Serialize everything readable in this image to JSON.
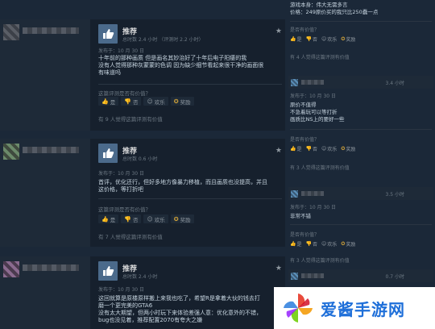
{
  "left_reviews": [
    {
      "recommendation": "推荐",
      "hours": "总时数 2.4 小时  （评测时 2.2 小时）",
      "posted": "发布于：10 月 30 日",
      "text": "十年前的那种画质 但是画名其妙治好了十年后电子阳痿的我\n没有人觉得那种灰蒙蒙的色调 因为缺少细节看起来很干净的画面很\n有味道吗",
      "helpful_question": "这篇评测是否有价值？",
      "votes": [
        "是",
        "否",
        "欢乐",
        "奖励"
      ],
      "found_helpful": "有 9 人觉得这篇评测有价值"
    },
    {
      "recommendation": "推荐",
      "hours": "总时数 0.6 小时",
      "posted": "发布于：10 月 30 日",
      "text": "首评，优化还行，但好多地方像暴力移植，而且画质也没提高，并且\n这价格，等打折吧",
      "helpful_question": "这篇评测是否有价值？",
      "votes": [
        "是",
        "否",
        "欢乐",
        "奖励"
      ],
      "found_helpful": "有 7 人觉得这篇评测有价值"
    },
    {
      "recommendation": "推荐",
      "hours": "总时数 2.4 小时",
      "posted": "发布于：10 月 30 日",
      "text": "这回就算是原楼原样搬上来我也吃了，希望R是拿着大伙的钱去打\n磨一个更完美的GTA6\n没有太大期望，但两小时玩下来体验差强人意：优化意外的不错，\nbug也没见着，推荐配置2070有夸大之嫌"
    }
  ],
  "right_column": {
    "top_lines": [
      "游戏本身：伟大无需多言",
      "价格：249原价买的我只比250蠢一点"
    ],
    "top_helpful_question": "是否有价值？",
    "top_votes": [
      "是",
      "否",
      "欢乐",
      "奖励"
    ],
    "top_found": "有 4 人觉得这篇评测有价值",
    "reviews": [
      {
        "hours": "3.4 小时",
        "posted": "发布于：10 月 30 日",
        "text": "原价不值得\n不急着玩可以等打折\n画质比NS上的要好一些",
        "helpful_question": "是否有价值？",
        "votes": [
          "是",
          "否",
          "欢乐",
          "奖励"
        ],
        "found": "有 3 人觉得这篇评测有价值"
      },
      {
        "hours": "3.5 小时",
        "posted": "发布于：10 月 30 日",
        "text": "非常不错",
        "helpful_question": "是否有价值？",
        "votes": [
          "是",
          "否",
          "欢乐",
          "奖励"
        ],
        "found": "有 3 人觉得这篇评测有价值"
      },
      {
        "hours": "0.7 小时"
      }
    ]
  },
  "watermark": {
    "text": "爱酱手游网"
  },
  "colors": {
    "background": "#1b2838",
    "accent": "#4b6a8b",
    "award": "#d6a63a"
  }
}
